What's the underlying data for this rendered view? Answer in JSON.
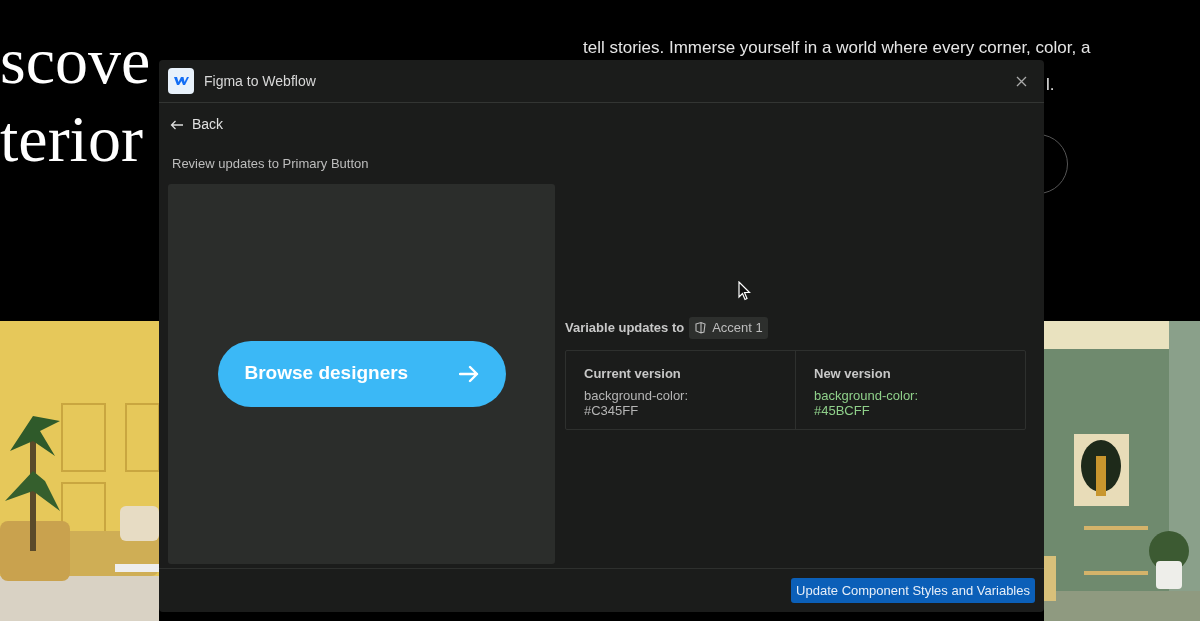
{
  "background_page": {
    "heading_lines": [
      "scove",
      "terior"
    ],
    "paragraph_lines": [
      "tell stories. Immerse yourself in a world where every corner, color, a",
      "l."
    ]
  },
  "dialog": {
    "title": "Figma to Webflow",
    "back": "Back",
    "subtitle": "Review updates to Primary Button",
    "preview": {
      "button_label": "Browse designers"
    },
    "variable_updates": {
      "label": "Variable updates to",
      "variable": "Accent 1"
    },
    "versions": [
      {
        "heading": "Current version",
        "lines": [
          "background-color:",
          "#C345FF"
        ],
        "changed": false
      },
      {
        "heading": "New version",
        "lines": [
          "background-color:",
          "#45BCFF"
        ],
        "changed": true
      }
    ],
    "primary_action": "Update Component Styles and Variables"
  }
}
